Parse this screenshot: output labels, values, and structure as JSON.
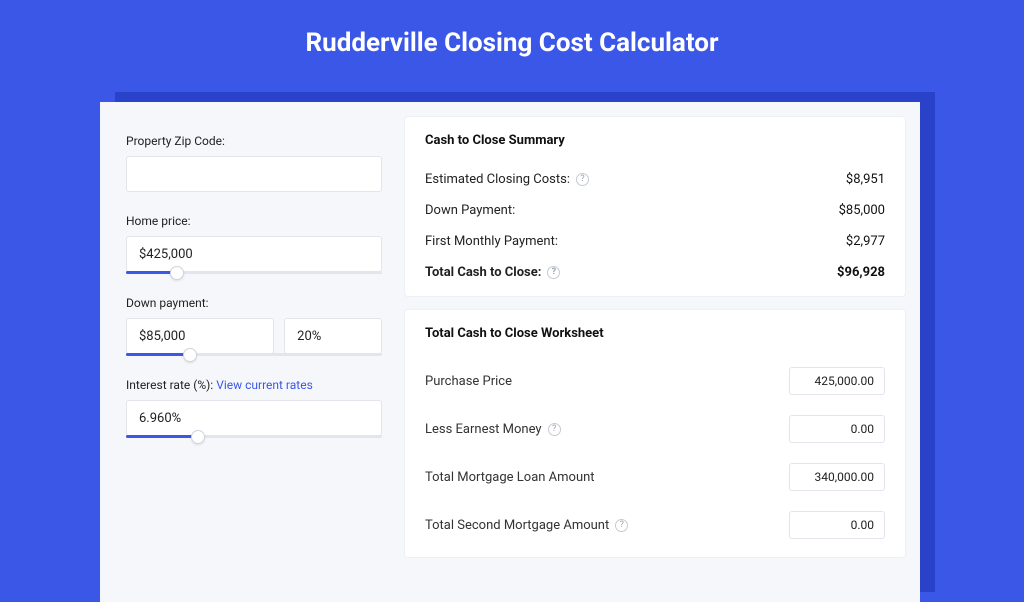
{
  "header": {
    "title": "Rudderville Closing Cost Calculator"
  },
  "left": {
    "zip_label": "Property Zip Code:",
    "zip_value": "",
    "home_price_label": "Home price:",
    "home_price_value": "$425,000",
    "home_price_slider_pct": 20,
    "down_payment_label": "Down payment:",
    "down_payment_value": "$85,000",
    "down_payment_pct": "20%",
    "down_payment_slider_pct": 25,
    "interest_label": "Interest rate (%):",
    "interest_link": "View current rates",
    "interest_value": "6.960%",
    "interest_slider_pct": 28
  },
  "summary": {
    "title": "Cash to Close Summary",
    "rows": [
      {
        "label": "Estimated Closing Costs:",
        "help": true,
        "value": "$8,951",
        "bold": false
      },
      {
        "label": "Down Payment:",
        "help": false,
        "value": "$85,000",
        "bold": false
      },
      {
        "label": "First Monthly Payment:",
        "help": false,
        "value": "$2,977",
        "bold": false
      },
      {
        "label": "Total Cash to Close:",
        "help": true,
        "value": "$96,928",
        "bold": true
      }
    ]
  },
  "worksheet": {
    "title": "Total Cash to Close Worksheet",
    "rows": [
      {
        "label": "Purchase Price",
        "help": false,
        "value": "425,000.00"
      },
      {
        "label": "Less Earnest Money",
        "help": true,
        "value": "0.00"
      },
      {
        "label": "Total Mortgage Loan Amount",
        "help": false,
        "value": "340,000.00"
      },
      {
        "label": "Total Second Mortgage Amount",
        "help": true,
        "value": "0.00"
      }
    ]
  }
}
